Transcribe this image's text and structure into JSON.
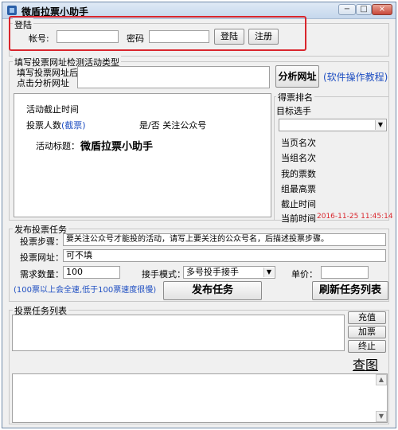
{
  "window": {
    "title": "微盾拉票小助手",
    "min": "−",
    "max": "□",
    "close": "×"
  },
  "login": {
    "group": "登陆",
    "account_label": "帐号:",
    "password_label": "密码",
    "login_btn": "登陆",
    "register_btn": "注册"
  },
  "detect": {
    "group": "填写投票网址检测活动类型",
    "url_hint": "填写投票网址后\n点击分析网址",
    "analyze_btn": "分析网址",
    "tutorial_link": "(软件操作教程)"
  },
  "activity": {
    "deadline_label": "活动截止时间",
    "voters_label": "投票人数",
    "voters_value": "(截票)",
    "follow_label": "是/否 关注公众号",
    "title_label": "活动标题：",
    "title_value": "微盾拉票小助手"
  },
  "rank": {
    "group": "得票排名",
    "target_label": "目标选手",
    "items": [
      "当页名次",
      "当组名次",
      "我的票数",
      "组最高票",
      "截止时间"
    ],
    "current_time_label": "当前时间",
    "current_time_value": "2016-11-25 11:45:14"
  },
  "publish": {
    "group": "发布投票任务",
    "steps_label": "投票步骤：",
    "steps_value": "要关注公众号才能投的活动，请写上要关注的公众号名，后描述投票步骤。",
    "url_label": "投票网址：",
    "url_value": "可不填",
    "qty_label": "需求数量：",
    "qty_value": "100",
    "mode_label": "接手模式：",
    "mode_value": "多号投手接手",
    "price_label": "单价：",
    "speed_note": "(100票以上会全速,低于100票速度很慢)",
    "publish_btn": "发布任务",
    "refresh_btn": "刷新任务列表"
  },
  "tasks": {
    "group": "投票任务列表",
    "recharge_btn": "充值",
    "add_btn": "加票",
    "stop_btn": "终止",
    "check_link": "查图"
  },
  "colors": {
    "highlight": "#d9262d",
    "link": "#1f4fc2",
    "time": "#d9262d"
  }
}
